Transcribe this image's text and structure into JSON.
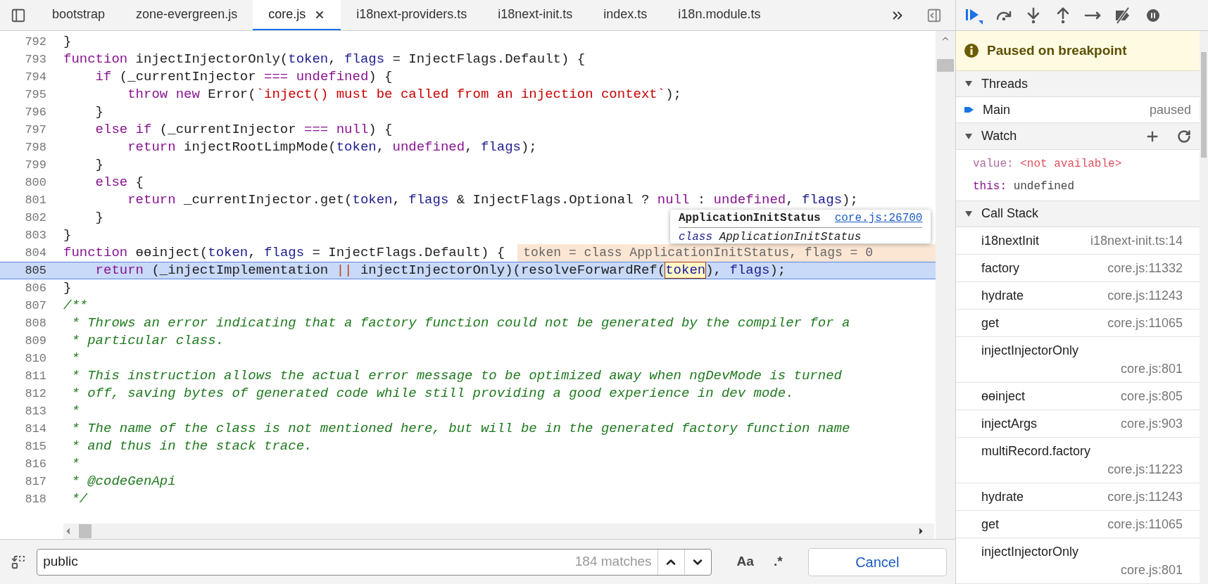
{
  "tabs": [
    {
      "label": "bootstrap",
      "selected": false,
      "closable": false
    },
    {
      "label": "zone-evergreen.js",
      "selected": false,
      "closable": false
    },
    {
      "label": "core.js",
      "selected": true,
      "closable": true
    },
    {
      "label": "i18next-providers.ts",
      "selected": false,
      "closable": false
    },
    {
      "label": "i18next-init.ts",
      "selected": false,
      "closable": false
    },
    {
      "label": "index.ts",
      "selected": false,
      "closable": false
    },
    {
      "label": "i18n.module.ts",
      "selected": false,
      "closable": false
    }
  ],
  "editor": {
    "lines": [
      {
        "number": "792",
        "current": false,
        "tokens": [
          {
            "kind": "plain",
            "text": "}"
          }
        ]
      },
      {
        "number": "793",
        "current": false,
        "tokens": [
          {
            "kind": "keyword",
            "text": "function"
          },
          {
            "kind": "plain",
            "text": " injectInjectorOnly("
          },
          {
            "kind": "param",
            "text": "token"
          },
          {
            "kind": "plain",
            "text": ", "
          },
          {
            "kind": "param",
            "text": "flags"
          },
          {
            "kind": "plain",
            "text": " = InjectFlags.Default) {"
          }
        ]
      },
      {
        "number": "794",
        "current": false,
        "tokens": [
          {
            "kind": "keyword",
            "text": "    if"
          },
          {
            "kind": "plain",
            "text": " (_currentInjector "
          },
          {
            "kind": "keyword",
            "text": "==="
          },
          {
            "kind": "keyword",
            "text": " undefined"
          },
          {
            "kind": "plain",
            "text": ") {"
          }
        ]
      },
      {
        "number": "795",
        "current": false,
        "tokens": [
          {
            "kind": "keyword",
            "text": "        throw new"
          },
          {
            "kind": "plain",
            "text": " Error("
          },
          {
            "kind": "string",
            "text": "`inject() must be called from an injection context`"
          },
          {
            "kind": "plain",
            "text": ");"
          }
        ]
      },
      {
        "number": "796",
        "current": false,
        "tokens": [
          {
            "kind": "plain",
            "text": "    }"
          }
        ]
      },
      {
        "number": "797",
        "current": false,
        "tokens": [
          {
            "kind": "keyword",
            "text": "    else if"
          },
          {
            "kind": "plain",
            "text": " (_currentInjector "
          },
          {
            "kind": "keyword",
            "text": "==="
          },
          {
            "kind": "keyword",
            "text": " null"
          },
          {
            "kind": "plain",
            "text": ") {"
          }
        ]
      },
      {
        "number": "798",
        "current": false,
        "tokens": [
          {
            "kind": "keyword",
            "text": "        return"
          },
          {
            "kind": "plain",
            "text": " injectRootLimpMode("
          },
          {
            "kind": "param",
            "text": "token"
          },
          {
            "kind": "plain",
            "text": ", "
          },
          {
            "kind": "keyword",
            "text": "undefined"
          },
          {
            "kind": "plain",
            "text": ", "
          },
          {
            "kind": "param",
            "text": "flags"
          },
          {
            "kind": "plain",
            "text": ");"
          }
        ]
      },
      {
        "number": "799",
        "current": false,
        "tokens": [
          {
            "kind": "plain",
            "text": "    }"
          }
        ]
      },
      {
        "number": "800",
        "current": false,
        "tokens": [
          {
            "kind": "keyword",
            "text": "    else"
          },
          {
            "kind": "plain",
            "text": " {"
          }
        ]
      },
      {
        "number": "801",
        "current": false,
        "tokens": [
          {
            "kind": "keyword",
            "text": "        return"
          },
          {
            "kind": "plain",
            "text": " _currentInjector.get("
          },
          {
            "kind": "param",
            "text": "token"
          },
          {
            "kind": "plain",
            "text": ", "
          },
          {
            "kind": "param",
            "text": "flags"
          },
          {
            "kind": "plain",
            "text": " & InjectFlags.Optional ? "
          },
          {
            "kind": "keyword",
            "text": "null"
          },
          {
            "kind": "plain",
            "text": " : "
          },
          {
            "kind": "keyword",
            "text": "undefined"
          },
          {
            "kind": "plain",
            "text": ", "
          },
          {
            "kind": "param",
            "text": "flags"
          },
          {
            "kind": "plain",
            "text": ");"
          }
        ]
      },
      {
        "number": "802",
        "current": false,
        "tokens": [
          {
            "kind": "plain",
            "text": "    }"
          }
        ]
      },
      {
        "number": "803",
        "current": false,
        "tokens": [
          {
            "kind": "plain",
            "text": "}"
          }
        ]
      },
      {
        "number": "804",
        "current": false,
        "inline_value": "token = class ApplicationInitStatus, flags = 0",
        "tokens": [
          {
            "kind": "keyword",
            "text": "function"
          },
          {
            "kind": "plain",
            "text": " ɵɵinject("
          },
          {
            "kind": "param",
            "text": "token"
          },
          {
            "kind": "plain",
            "text": ", "
          },
          {
            "kind": "param",
            "text": "flags"
          },
          {
            "kind": "plain",
            "text": " = InjectFlags.Default) {"
          }
        ]
      },
      {
        "number": "805",
        "current": true,
        "tokens": [
          {
            "kind": "keyword",
            "text": "    return"
          },
          {
            "kind": "plain",
            "text": " (_injectImplementation "
          },
          {
            "kind": "operator",
            "text": "||"
          },
          {
            "kind": "plain",
            "text": " injectInjectorOnly)(resolveForwardRef("
          },
          {
            "kind": "hovered",
            "text": "token"
          },
          {
            "kind": "plain",
            "text": "), "
          },
          {
            "kind": "param",
            "text": "flags"
          },
          {
            "kind": "plain",
            "text": ");"
          }
        ]
      },
      {
        "number": "806",
        "current": false,
        "tokens": [
          {
            "kind": "plain",
            "text": "}"
          }
        ]
      },
      {
        "number": "807",
        "current": false,
        "tokens": [
          {
            "kind": "comment",
            "text": "/**"
          }
        ]
      },
      {
        "number": "808",
        "current": false,
        "tokens": [
          {
            "kind": "comment",
            "text": " * Throws an error indicating that a factory function could not be generated by the compiler for a"
          }
        ]
      },
      {
        "number": "809",
        "current": false,
        "tokens": [
          {
            "kind": "comment",
            "text": " * particular class."
          }
        ]
      },
      {
        "number": "810",
        "current": false,
        "tokens": [
          {
            "kind": "comment",
            "text": " *"
          }
        ]
      },
      {
        "number": "811",
        "current": false,
        "tokens": [
          {
            "kind": "comment",
            "text": " * This instruction allows the actual error message to be optimized away when ngDevMode is turned"
          }
        ]
      },
      {
        "number": "812",
        "current": false,
        "tokens": [
          {
            "kind": "comment",
            "text": " * off, saving bytes of generated code while still providing a good experience in dev mode."
          }
        ]
      },
      {
        "number": "813",
        "current": false,
        "tokens": [
          {
            "kind": "comment",
            "text": " *"
          }
        ]
      },
      {
        "number": "814",
        "current": false,
        "tokens": [
          {
            "kind": "comment",
            "text": " * The name of the class is not mentioned here, but will be in the generated factory function name"
          }
        ]
      },
      {
        "number": "815",
        "current": false,
        "tokens": [
          {
            "kind": "comment",
            "text": " * and thus in the stack trace."
          }
        ]
      },
      {
        "number": "816",
        "current": false,
        "tokens": [
          {
            "kind": "comment",
            "text": " *"
          }
        ]
      },
      {
        "number": "817",
        "current": false,
        "tokens": [
          {
            "kind": "comment",
            "text": " * @codeGenApi"
          }
        ]
      },
      {
        "number": "818",
        "current": false,
        "tokens": [
          {
            "kind": "comment",
            "text": " */"
          }
        ]
      }
    ],
    "tooltip": {
      "title": "ApplicationInitStatus",
      "link": "core.js:26700",
      "keyword": "class",
      "name": "ApplicationInitStatus"
    }
  },
  "search": {
    "value": "public",
    "matches": "184 matches",
    "match_case": "Aa",
    "regex": ".*",
    "cancel": "Cancel"
  },
  "debugger": {
    "banner": "Paused on breakpoint",
    "threads": {
      "title": "Threads",
      "expanded": true,
      "items": [
        {
          "name": "Main",
          "status": "paused",
          "selected": true
        }
      ]
    },
    "watch": {
      "title": "Watch",
      "expanded": true,
      "items": [
        {
          "name": "value:",
          "value": "<not available>",
          "available": false
        },
        {
          "name": "this:",
          "value": "undefined",
          "available": true
        }
      ]
    },
    "call_stack": {
      "title": "Call Stack",
      "expanded": true,
      "frames": [
        {
          "name": "i18nextInit",
          "location": "i18next-init.ts:14"
        },
        {
          "name": "factory",
          "location": "core.js:11332"
        },
        {
          "name": "hydrate",
          "location": "core.js:11243"
        },
        {
          "name": "get",
          "location": "core.js:11065"
        },
        {
          "name": "injectInjectorOnly",
          "location": "core.js:801"
        },
        {
          "name": "ɵɵinject",
          "location": "core.js:805"
        },
        {
          "name": "injectArgs",
          "location": "core.js:903"
        },
        {
          "name": "multiRecord.factory",
          "location": "core.js:11223"
        },
        {
          "name": "hydrate",
          "location": "core.js:11243"
        },
        {
          "name": "get",
          "location": "core.js:11065"
        },
        {
          "name": "injectInjectorOnly",
          "location": "core.js:801"
        }
      ]
    }
  }
}
